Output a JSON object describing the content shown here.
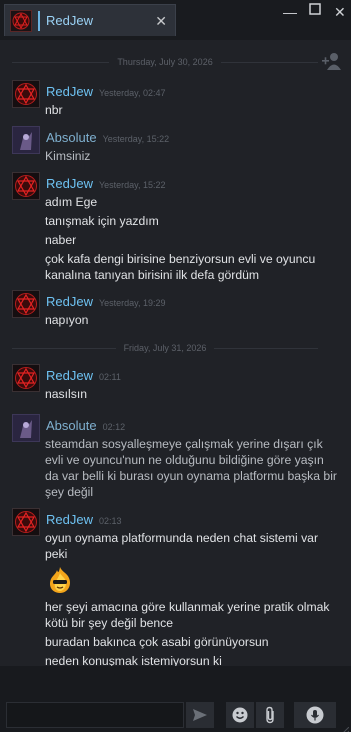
{
  "window": {
    "tab_name": "RedJew"
  },
  "separators": [
    {
      "label": "Thursday, July 30, 2026"
    },
    {
      "label": "Friday, July 31, 2026"
    }
  ],
  "messages": [
    {
      "sender": "RedJew",
      "time": "Yesterday, 02:47",
      "lines": [
        "nbr"
      ]
    },
    {
      "sender": "Absolute",
      "time": "Yesterday, 15:22",
      "lines": [
        "Kimsiniz"
      ]
    },
    {
      "sender": "RedJew",
      "time": "Yesterday, 15:22",
      "lines": [
        "adım Ege",
        "tanışmak için yazdım",
        "naber",
        "çok kafa dengi birisine benziyorsun evli ve oyuncu kanalına tanıyan birisini ilk defa gördüm"
      ]
    },
    {
      "sender": "RedJew",
      "time": "Yesterday, 19:29",
      "lines": [
        "napıyon"
      ]
    },
    {
      "sender": "RedJew",
      "time": "02:11",
      "lines": [
        "nasılsın"
      ]
    },
    {
      "sender": "Absolute",
      "time": "02:12",
      "lines": [
        "steamdan sosyalleşmeye çalışmak yerine dışarı çık evli ve oyuncu'nun ne olduğunu bildiğine göre yaşın da var belli ki burası oyun oynama platformu başka bir şey değil"
      ]
    },
    {
      "sender": "RedJew",
      "time": "02:13",
      "lines": [
        "oyun oynama platformunda neden chat sistemi var peki",
        "her şeyi amacına göre kullanmak yerine pratik olmak kötü bir şey değil bence",
        "buradan bakınca çok asabi görünüyorsun",
        "neden konuşmak istemiyorsun ki"
      ]
    }
  ],
  "composer": {
    "input_value": ""
  },
  "colors": {
    "background": "#202227",
    "sender_red": "#6ec2f2",
    "accent": "#6bb5e4"
  },
  "icons": [
    "close-icon",
    "minimize-icon",
    "maximize-icon",
    "window-close-icon",
    "add-user-icon",
    "send-icon",
    "emoji-icon",
    "attach-icon",
    "voice-icon",
    "sticker-icon"
  ]
}
